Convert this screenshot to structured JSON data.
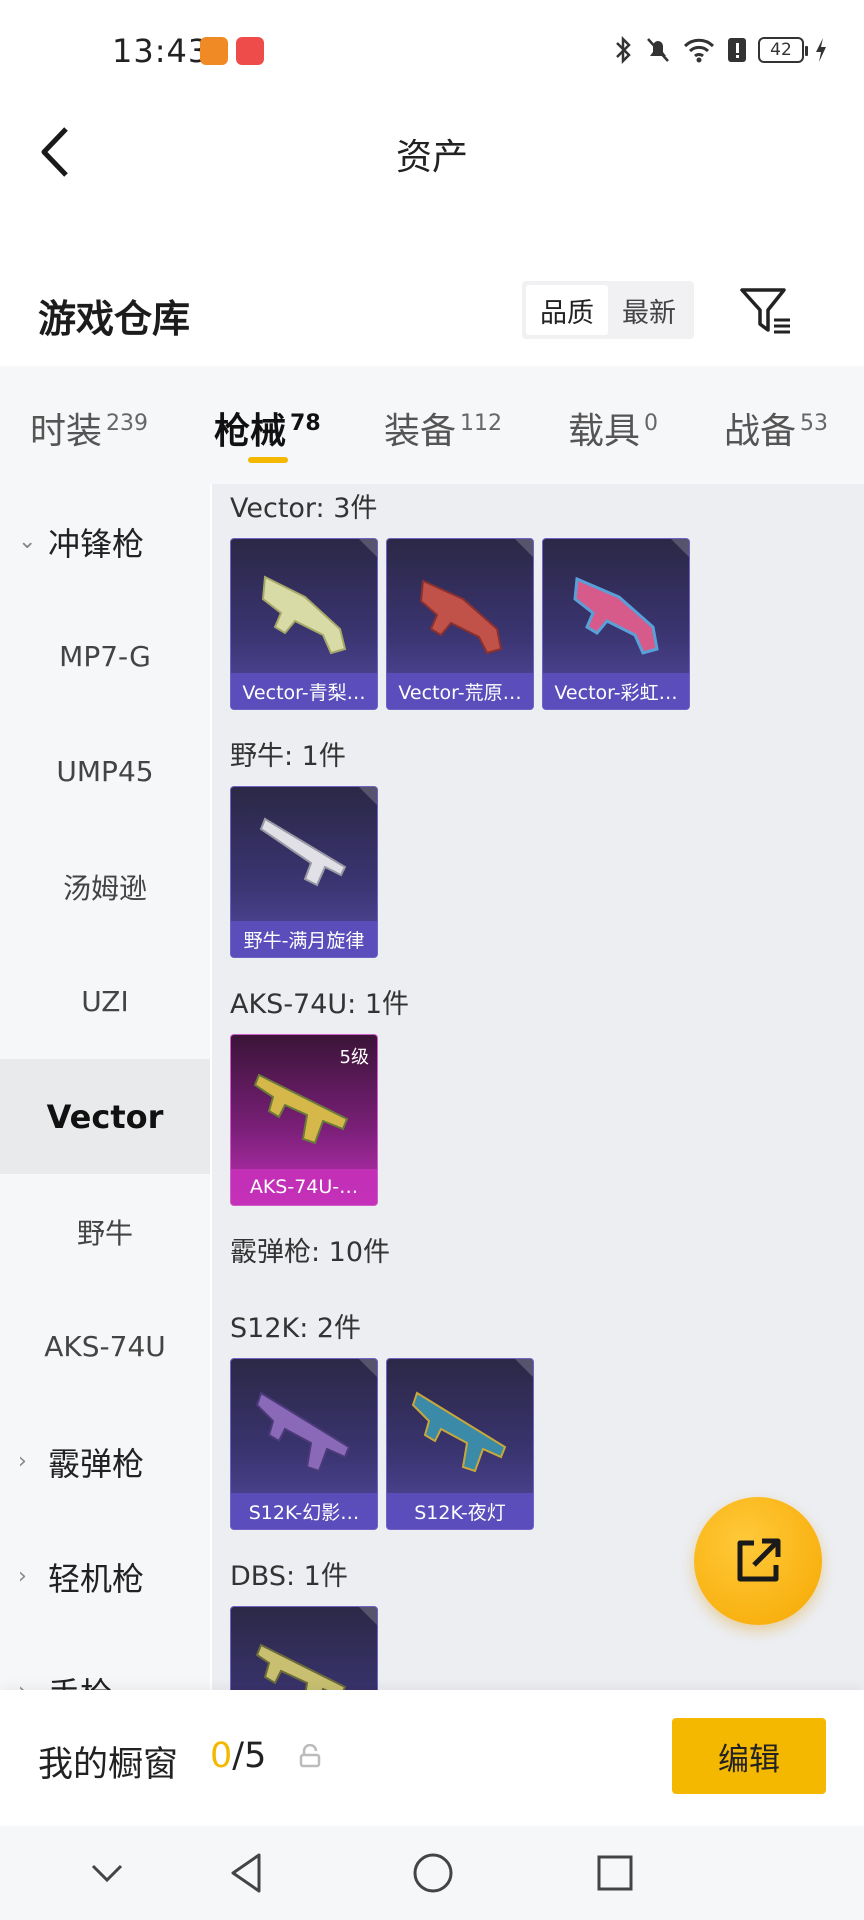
{
  "status_bar": {
    "time": "13:43",
    "battery": "42"
  },
  "header": {
    "title": "资产"
  },
  "warehouse": {
    "title": "游戏仓库",
    "sort_options": [
      {
        "label": "品质",
        "selected": true
      },
      {
        "label": "最新",
        "selected": false
      }
    ]
  },
  "tabs": [
    {
      "label": "时装",
      "count": "239"
    },
    {
      "label": "枪械",
      "count": "78",
      "active": true
    },
    {
      "label": "装备",
      "count": "112"
    },
    {
      "label": "载具",
      "count": "0"
    },
    {
      "label": "战备",
      "count": "53"
    }
  ],
  "sidebar": {
    "items": [
      {
        "label": "冲锋枪",
        "type": "category",
        "expanded": true
      },
      {
        "label": "MP7-G"
      },
      {
        "label": "UMP45"
      },
      {
        "label": "汤姆逊"
      },
      {
        "label": "UZI"
      },
      {
        "label": "Vector",
        "active": true
      },
      {
        "label": "野牛"
      },
      {
        "label": "AKS-74U"
      },
      {
        "label": "霰弹枪",
        "type": "category"
      },
      {
        "label": "轻机枪",
        "type": "category"
      },
      {
        "label": "手枪",
        "type": "category"
      }
    ]
  },
  "groups": [
    {
      "title": "Vector: 3件",
      "items": [
        {
          "name": "Vector-青梨…",
          "rarity": "purple"
        },
        {
          "name": "Vector-荒原…",
          "rarity": "purple"
        },
        {
          "name": "Vector-彩虹…",
          "rarity": "purple"
        }
      ]
    },
    {
      "title": "野牛: 1件",
      "items": [
        {
          "name": "野牛-满月旋律",
          "rarity": "purple"
        }
      ]
    },
    {
      "title": "AKS-74U: 1件",
      "items": [
        {
          "name": "AKS-74U-…",
          "rarity": "pink",
          "level": "5级"
        }
      ]
    },
    {
      "title": "霰弹枪: 10件",
      "items": []
    },
    {
      "title": "S12K: 2件",
      "items": [
        {
          "name": "S12K-幻影…",
          "rarity": "purple"
        },
        {
          "name": "S12K-夜灯",
          "rarity": "purple"
        }
      ]
    },
    {
      "title": "DBS: 1件",
      "items": [
        {
          "name": "",
          "rarity": "purple"
        }
      ]
    }
  ],
  "showcase": {
    "label": "我的橱窗",
    "current": "0",
    "total": "/5",
    "edit_label": "编辑"
  },
  "colors": {
    "accent": "#f5b800",
    "purple_card": "#544aa0",
    "pink_card": "#c232b9"
  }
}
